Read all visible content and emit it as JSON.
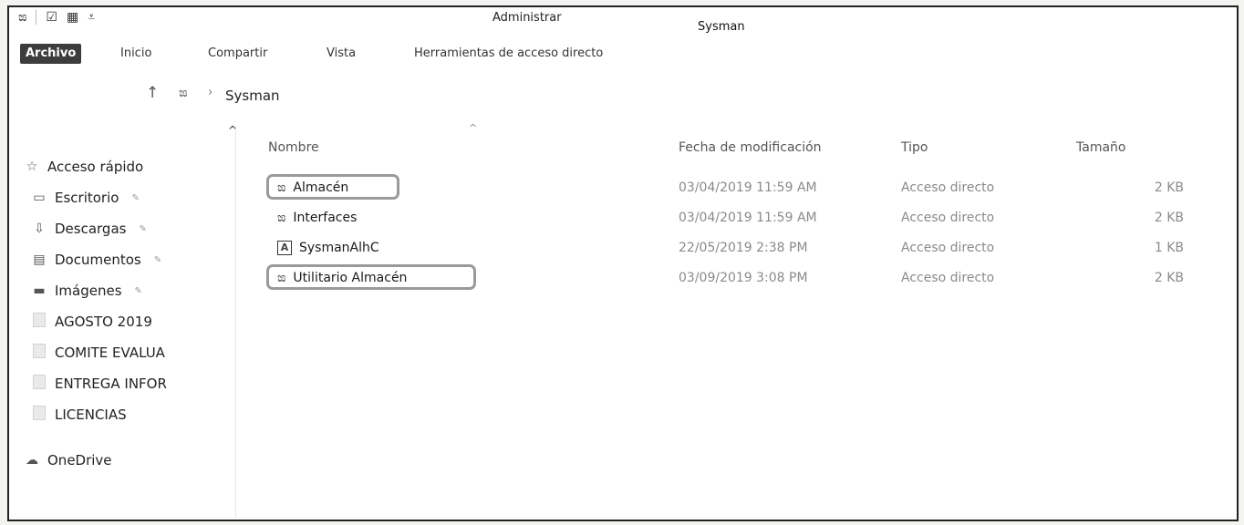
{
  "window": {
    "title": "Sysman",
    "context_tab_title": "Administrar"
  },
  "quick_access_toolbar": {
    "icons": [
      "app-icon",
      "properties-icon",
      "new-folder-icon",
      "customize-icon"
    ]
  },
  "ribbon": {
    "tabs": [
      "Archivo",
      "Inicio",
      "Compartir",
      "Vista",
      "Herramientas de acceso directo"
    ]
  },
  "address_bar": {
    "path": "Sysman"
  },
  "navigation": {
    "items": [
      {
        "label": "Acceso rápido",
        "icon": "star-icon"
      },
      {
        "label": "Escritorio",
        "icon": "desktop-icon",
        "pinned": true
      },
      {
        "label": "Descargas",
        "icon": "download-icon",
        "pinned": true
      },
      {
        "label": "Documentos",
        "icon": "document-icon",
        "pinned": true
      },
      {
        "label": "Imágenes",
        "icon": "pictures-icon",
        "pinned": true
      },
      {
        "label": "AGOSTO 2019",
        "icon": "folder-icon"
      },
      {
        "label": "COMITE EVALUA",
        "icon": "folder-icon"
      },
      {
        "label": "ENTREGA INFOR",
        "icon": "folder-icon"
      },
      {
        "label": "LICENCIAS",
        "icon": "folder-icon"
      },
      {
        "label": "OneDrive",
        "icon": "cloud-icon"
      }
    ]
  },
  "file_list": {
    "columns": [
      "Nombre",
      "Fecha de modificación",
      "Tipo",
      "Tamaño"
    ],
    "rows": [
      {
        "name": "Almacén",
        "date": "03/04/2019 11:59 AM",
        "type": "Acceso directo",
        "size": "2 KB",
        "highlighted": true
      },
      {
        "name": "Interfaces",
        "date": "03/04/2019 11:59 AM",
        "type": "Acceso directo",
        "size": "2 KB",
        "highlighted": false
      },
      {
        "name": "SysmanAlhC",
        "date": "22/05/2019 2:38 PM",
        "type": "Acceso directo",
        "size": "1 KB",
        "highlighted": false
      },
      {
        "name": "Utilitario Almacén",
        "date": "03/09/2019 3:08 PM",
        "type": "Acceso directo",
        "size": "2 KB",
        "highlighted": true
      }
    ]
  }
}
